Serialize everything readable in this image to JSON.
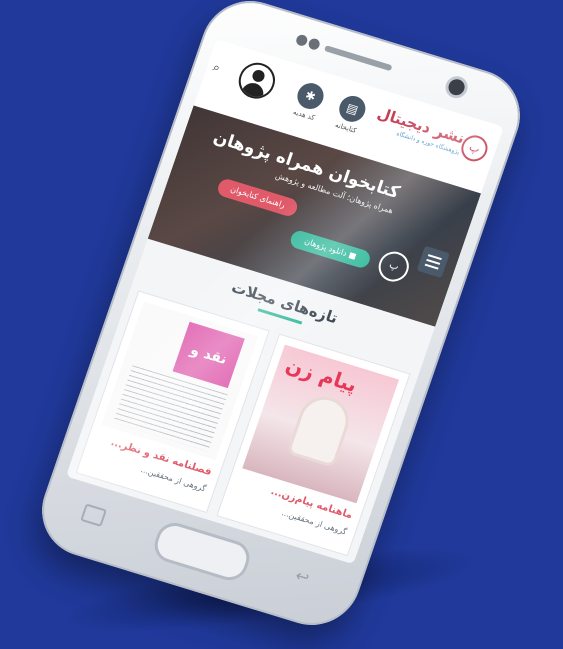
{
  "app": {
    "brand_name": "نشر دیجیتال",
    "brand_tagline": "پژوهشگاه حوزه و دانشگاه",
    "brand_emblem": "پ",
    "nav_library": "کتابخانه",
    "nav_gift": "کد هدیه"
  },
  "hero": {
    "title": "کتابخوان همراه پژوهان",
    "subtitle": "همراه پژوهان؛ آلت مطالعه و پژوهش",
    "download_button": "دانلود پژوهان",
    "guide_button": "راهنمای کتابخوان",
    "badge": "پ"
  },
  "section": {
    "title": "تازه‌های مجلات"
  },
  "cards": [
    {
      "cover_title": "پیام زن",
      "title": "ماهنامه پیام‌زن...",
      "author": "گروهی از محققین..."
    },
    {
      "cover_title": "نقد و نظر",
      "title": "فصلنامه نقد و نظر...",
      "author": "گروهی از محققین..."
    }
  ],
  "colors": {
    "background": "#20399a",
    "accent_green": "#2eb89a",
    "accent_red": "#e05a6a",
    "brand": "#c73c52"
  },
  "icons": {
    "library": "books-icon",
    "gift": "gift-icon",
    "profile": "user-icon",
    "search": "search-icon",
    "menu": "hamburger-icon",
    "android": "android-icon"
  }
}
